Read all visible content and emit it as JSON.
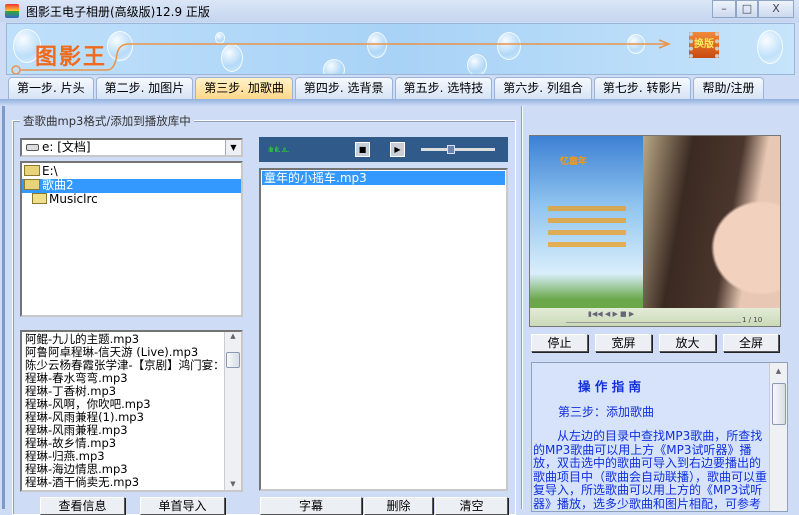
{
  "window": {
    "title": "图影王电子相册(高级版)12.9 正版",
    "minimize": "–",
    "maximize": "□",
    "close": "X"
  },
  "banner": {
    "logo": "图影王",
    "skin_button": "换版"
  },
  "tabs": [
    {
      "label": "第一步. 片头"
    },
    {
      "label": "第二步. 加图片"
    },
    {
      "label": "第三步. 加歌曲",
      "active": true
    },
    {
      "label": "第四步. 选背景"
    },
    {
      "label": "第五步. 选特技"
    },
    {
      "label": "第六步. 列组合"
    },
    {
      "label": "第七步. 转影片"
    },
    {
      "label": "帮助/注册"
    }
  ],
  "group_title": "查歌曲mp3格式/添加到播放库中",
  "drive": {
    "value": "e: [文档]"
  },
  "folders": [
    {
      "label": "E:\\"
    },
    {
      "label": "歌曲2",
      "selected": true
    },
    {
      "label": "Musiclrc"
    }
  ],
  "files": [
    "阿鲲-九儿的主题.mp3",
    "阿鲁阿卓程琳-信天游 (Live).mp3",
    "陈少云杨春霞张学津-【京剧】鸿门宴：",
    "程琳-春水弯弯.mp3",
    "程琳-丁香树.mp3",
    "程琳-风啊，你吹吧.mp3",
    "程琳-风雨兼程(1).mp3",
    "程琳-风雨兼程.mp3",
    "程琳-故乡情.mp3",
    "程琳-归燕.mp3",
    "程琳-海边情思.mp3",
    "程琳-酒干倘卖无.mp3"
  ],
  "left_buttons": {
    "info": "查看信息",
    "import_one": "单首导入"
  },
  "player": {
    "volume_percent": 40
  },
  "playlist": [
    "童年的小摇车.mp3"
  ],
  "playlist_buttons": {
    "subtitle": "字幕",
    "delete": "删除",
    "clear": "清空"
  },
  "preview": {
    "poem_title": "忆童年",
    "counter": "1 / 10"
  },
  "preview_buttons": {
    "stop": "停止",
    "wide": "宽屏",
    "zoom": "放大",
    "full": "全屏"
  },
  "guide": {
    "title": "操 作 指 南",
    "step": "第三步：添加歌曲",
    "body": "　　从左边的目录中查找MP3歌曲，所查找的MP3歌曲可以用上方《MP3试听器》播放，双击选中的歌曲可导入到右边要播出的歌曲项目中（歌曲会自动联播），歌曲可以重复导入，所选歌曲可以用上方的《MP3试听器》播放，选多少歌曲和图片相配，可参考"
  },
  "colors": {
    "accent": "#3399ff",
    "guide_text": "#1030e0",
    "logo": "#f06a1c"
  }
}
